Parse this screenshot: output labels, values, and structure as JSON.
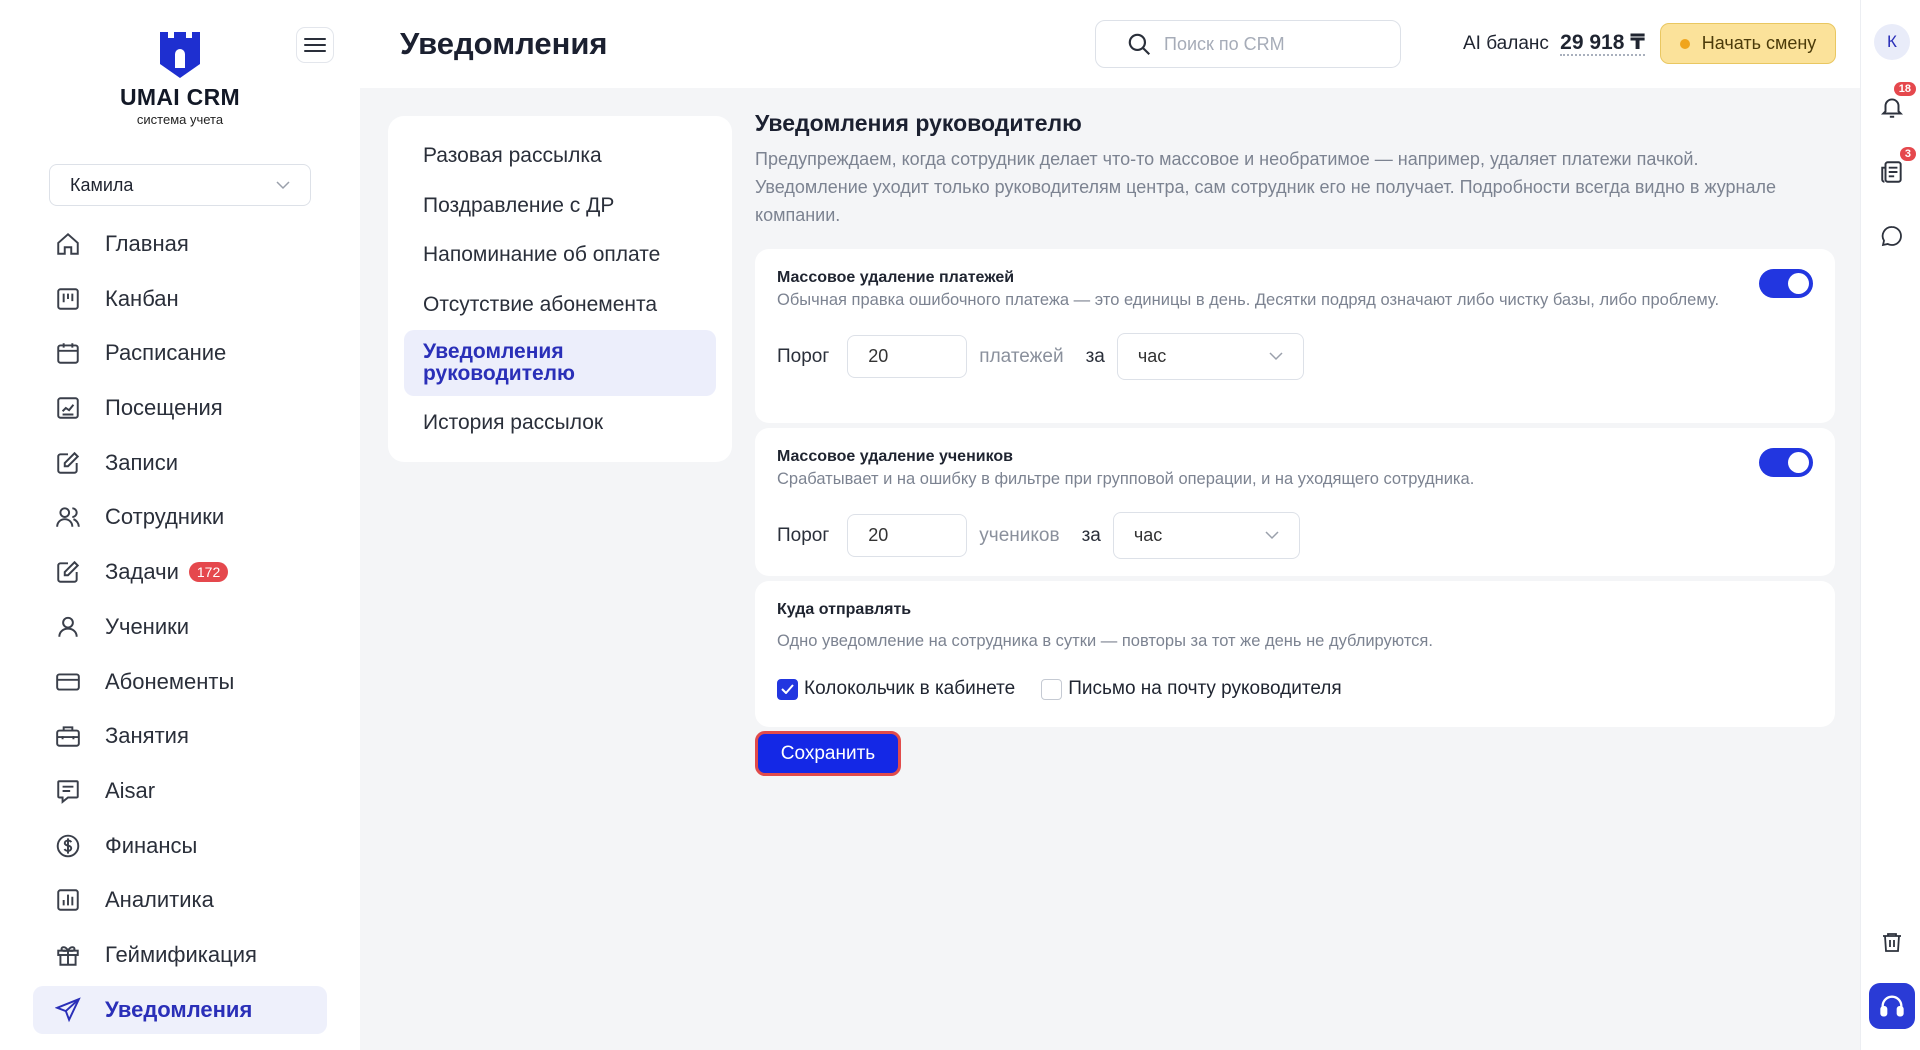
{
  "brand": {
    "name": "UMAI CRM",
    "subtitle": "система учета"
  },
  "branch": {
    "selected": "Камила"
  },
  "sidebar": {
    "items": [
      {
        "label": "Главная",
        "icon": "home-icon"
      },
      {
        "label": "Канбан",
        "icon": "kanban-icon"
      },
      {
        "label": "Расписание",
        "icon": "calendar-icon"
      },
      {
        "label": "Посещения",
        "icon": "chart-icon"
      },
      {
        "label": "Записи",
        "icon": "edit-icon"
      },
      {
        "label": "Сотрудники",
        "icon": "users-icon"
      },
      {
        "label": "Задачи",
        "icon": "tasks-icon",
        "badge": "172"
      },
      {
        "label": "Ученики",
        "icon": "user-icon"
      },
      {
        "label": "Абонементы",
        "icon": "card-icon"
      },
      {
        "label": "Занятия",
        "icon": "briefcase-icon"
      },
      {
        "label": "Aisar",
        "icon": "message-icon"
      },
      {
        "label": "Финансы",
        "icon": "dollar-icon"
      },
      {
        "label": "Аналитика",
        "icon": "analytics-icon"
      },
      {
        "label": "Геймификация",
        "icon": "gift-icon"
      },
      {
        "label": "Уведомления",
        "icon": "send-icon",
        "active": true
      }
    ]
  },
  "header": {
    "title": "Уведомления",
    "search_placeholder": "Поиск по CRM",
    "ai_balance_label": "AI баланс",
    "ai_balance_value": "29 918 ₸",
    "shift_button": "Начать смену"
  },
  "rail": {
    "avatar": "К",
    "notifications_badge": "18",
    "news_badge": "3"
  },
  "subnav": {
    "items": [
      {
        "label": "Разовая рассылка"
      },
      {
        "label": "Поздравление с ДР"
      },
      {
        "label": "Напоминание об оплате"
      },
      {
        "label": "Отсутствие абонемента"
      },
      {
        "label": "Уведомления руководителю",
        "active": true
      },
      {
        "label": "История рассылок"
      }
    ]
  },
  "main": {
    "title": "Уведомления руководителю",
    "description": "Предупреждаем, когда сотрудник делает что-то массовое и необратимое — например, удаляет платежи пачкой. Уведомление уходит только руководителям центра, сам сотрудник его не получает. Подробности всегда видно в журнале компании.",
    "payments": {
      "title": "Массовое удаление платежей",
      "description": "Обычная правка ошибочного платежа — это единицы в день. Десятки подряд означают либо чистку базы, либо проблему.",
      "enabled": true,
      "threshold_label": "Порог",
      "threshold_value": "20",
      "unit": "платежей",
      "per_label": "за",
      "period": "час"
    },
    "students": {
      "title": "Массовое удаление учеников",
      "description": "Срабатывает и на ошибку в фильтре при групповой операции, и на уходящего сотрудника.",
      "enabled": true,
      "threshold_label": "Порог",
      "threshold_value": "20",
      "unit": "учеников",
      "per_label": "за",
      "period": "час"
    },
    "delivery": {
      "title": "Куда отправлять",
      "description": "Одно уведомление на сотрудника в сутки — повторы за тот же день не дублируются.",
      "bell_label": "Колокольчик в кабинете",
      "bell_checked": true,
      "email_label": "Письмо на почту руководителя",
      "email_checked": false
    },
    "save_label": "Сохранить"
  },
  "colors": {
    "accent": "#2236e0",
    "badge": "#e5484d",
    "shift": "#fbe29a"
  }
}
